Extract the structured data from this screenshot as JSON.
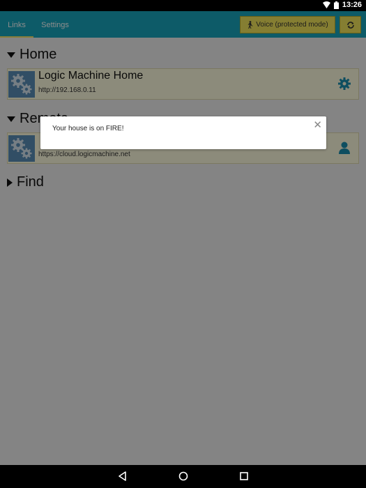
{
  "status_bar": {
    "time": "13:26"
  },
  "tabs": [
    {
      "label": "Links"
    },
    {
      "label": "Settings"
    }
  ],
  "voice_button": {
    "label": "Voice (protected mode)"
  },
  "sections": {
    "home": {
      "title": "Home"
    },
    "remote": {
      "title": "Remote"
    },
    "find": {
      "title": "Find"
    }
  },
  "cards": {
    "home": {
      "title": "Logic Machine Home",
      "url": "http://192.168.0.11"
    },
    "remote": {
      "title": "",
      "url": "https://cloud.logicmachine.net"
    }
  },
  "toast": {
    "message": "Your house is on FIRE!"
  },
  "colors": {
    "topbar": "#19a6bd",
    "accent": "#f3e65b",
    "icon": "#1a8fb0"
  }
}
